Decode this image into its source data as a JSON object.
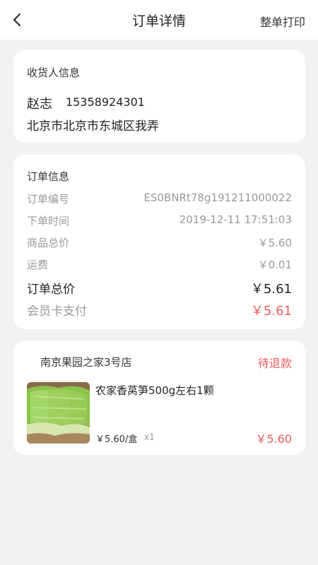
{
  "nav": {
    "title": "订单详情",
    "action": "整单打印"
  },
  "recipient": {
    "title": "收货人信息",
    "name": "赵志",
    "phone": "15358924301",
    "address": "北京市北京市东城区我弄"
  },
  "order": {
    "title": "订单信息",
    "rows": [
      {
        "label": "订单编号",
        "value": "ES0BNRt78g191211000022"
      },
      {
        "label": "下单时间",
        "value": "2019-12-11 17:51:03"
      },
      {
        "label": "商品总价",
        "value": "￥5.60"
      },
      {
        "label": "运费",
        "value": "￥0.01"
      }
    ],
    "total": {
      "label": "订单总价",
      "value": "￥5.61"
    },
    "paid": {
      "label": "会员卡支付",
      "value": "￥5.61"
    }
  },
  "store": {
    "name": "南京果园之家3号店",
    "status": "待退款",
    "product": {
      "name": "农家香莴笋500g左右1颗",
      "unit_price": "￥5.60/盒",
      "qty": "x1",
      "price": "￥5.60"
    }
  },
  "colors": {
    "accent_red": "#e85d5d",
    "background": "#f2f1f4"
  }
}
